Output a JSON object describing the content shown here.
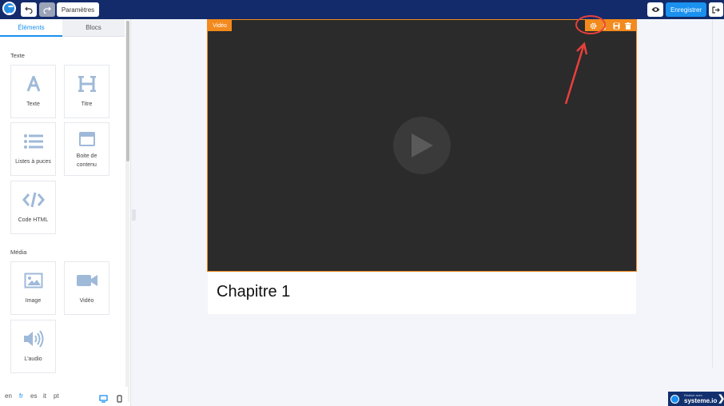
{
  "toolbar": {
    "params_label": "Paramètres",
    "save_label": "Enregistrer"
  },
  "panel": {
    "tabs": [
      {
        "label": "Éléments",
        "active": true
      },
      {
        "label": "Blocs",
        "active": false
      }
    ],
    "sections": {
      "text_title": "Texte",
      "media_title": "Média"
    },
    "text_items": [
      {
        "label": "Texte",
        "icon": "letter-a-icon"
      },
      {
        "label": "Titre",
        "icon": "letter-h-icon"
      },
      {
        "label": "Listes à puces",
        "icon": "bullet-list-icon"
      },
      {
        "label": "Boite de contenu",
        "icon": "content-box-icon"
      },
      {
        "label": "Code HTML",
        "icon": "code-icon"
      }
    ],
    "media_items": [
      {
        "label": "Image",
        "icon": "image-icon"
      },
      {
        "label": "Vidéo",
        "icon": "video-camera-icon"
      },
      {
        "label": "L'audio",
        "icon": "speaker-icon"
      }
    ],
    "languages": [
      "en",
      "fr",
      "es",
      "it",
      "pt"
    ],
    "active_language": "fr"
  },
  "canvas": {
    "video_tag": "Vidéo",
    "chapter_title": "Chapitre 1"
  },
  "badge": {
    "small_text": "Réalisé avec",
    "name": "systeme.io"
  },
  "colors": {
    "topbar": "#132b6b",
    "accent": "#1a90ef",
    "selection": "#f28a1e",
    "highlight": "#e8403b"
  }
}
